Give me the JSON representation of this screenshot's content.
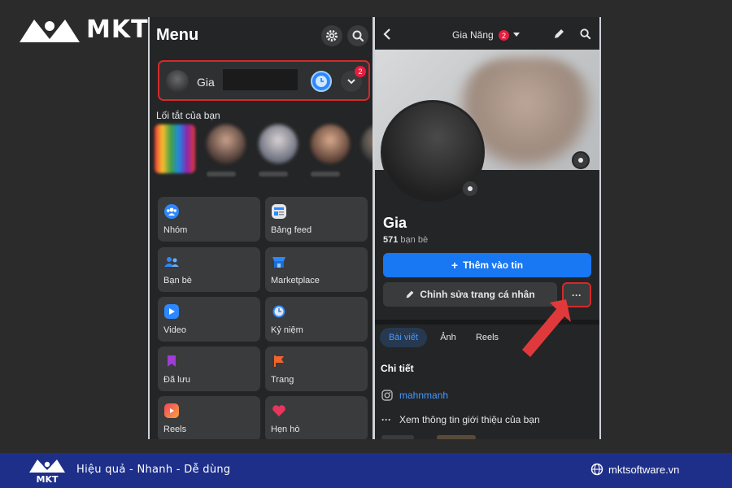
{
  "brand": {
    "name": "MKT",
    "color": "#ffffff"
  },
  "left_panel": {
    "title": "Menu",
    "profile_name": "Gia",
    "switch_badge": "2",
    "shortcuts_label": "Lối tắt của bạn",
    "tiles": [
      {
        "label": "Nhóm",
        "icon": "groups-icon",
        "color": "#2d88ff"
      },
      {
        "label": "Bảng feed",
        "icon": "feed-icon",
        "color": "#2d88ff"
      },
      {
        "label": "Bạn bè",
        "icon": "friends-icon",
        "color": "#2d88ff"
      },
      {
        "label": "Marketplace",
        "icon": "marketplace-icon",
        "color": "#2d88ff"
      },
      {
        "label": "Video",
        "icon": "video-icon",
        "color": "#2d88ff"
      },
      {
        "label": "Kỷ niệm",
        "icon": "memories-icon",
        "color": "#2d88ff"
      },
      {
        "label": "Đã lưu",
        "icon": "saved-icon",
        "color": "#a03cd7"
      },
      {
        "label": "Trang",
        "icon": "pages-icon",
        "color": "#f5632a"
      },
      {
        "label": "Reels",
        "icon": "reels-icon",
        "color": "#f0465a"
      },
      {
        "label": "Hẹn hò",
        "icon": "dating-icon",
        "color": "#e8355d"
      }
    ]
  },
  "right_panel": {
    "header_name": "Gia Năng",
    "header_badge": "2",
    "profile_name": "Gia",
    "friends_count": "571",
    "friends_label": " bạn bè",
    "add_story": "Thêm vào tin",
    "edit_profile": "Chỉnh sửa trang cá nhân",
    "more": "···",
    "tabs": [
      {
        "label": "Bài viết",
        "active": true
      },
      {
        "label": "Ảnh",
        "active": false
      },
      {
        "label": "Reels",
        "active": false
      }
    ],
    "details_title": "Chi tiết",
    "instagram": "mahnmanh",
    "about": "Xem thông tin giới thiệu của bạn"
  },
  "footer": {
    "tagline": "Hiệu quả - Nhanh - Dễ dùng",
    "website": "mktsoftware.vn",
    "bg_color": "#1e2f8a"
  },
  "colors": {
    "highlight": "#d32a2a",
    "arrow": "#e0393c",
    "primary": "#1877f2"
  }
}
